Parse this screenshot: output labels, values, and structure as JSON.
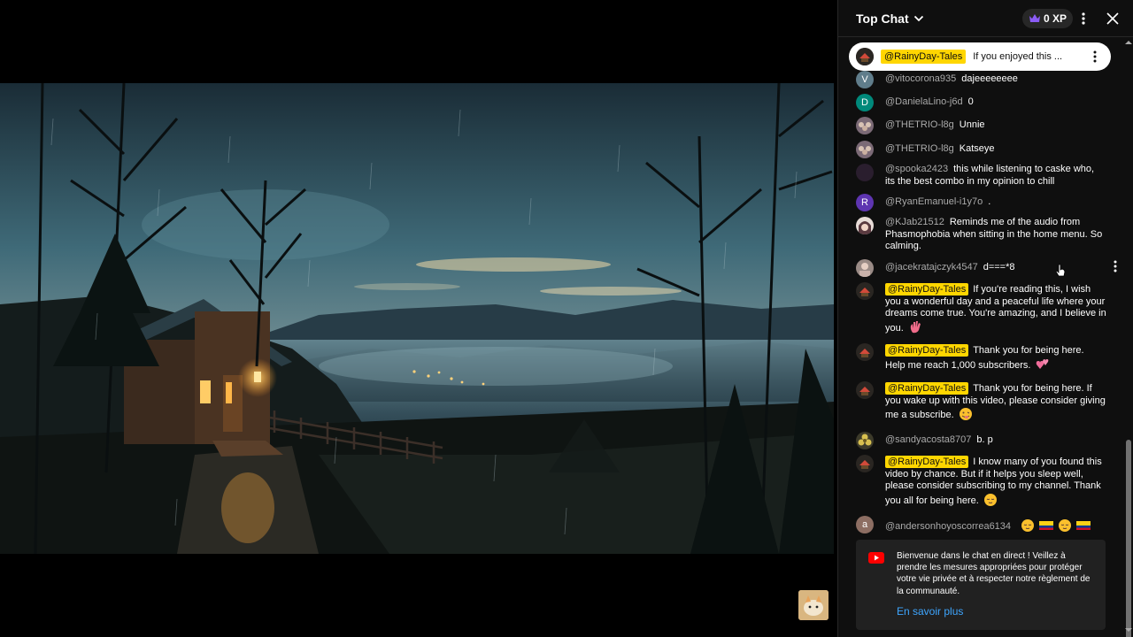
{
  "chat": {
    "title": "Top Chat",
    "xp": "0 XP",
    "pinned": {
      "author": "@RainyDay-Tales",
      "text": "If you enjoyed this ..."
    },
    "messages": [
      {
        "author": "@vitocorona935",
        "text": "dajeeeeeeee",
        "avatar_letter": "V",
        "avatar_color": "#607d8b"
      },
      {
        "author": "@DanielaLino-j6d",
        "text": "0",
        "avatar_letter": "D",
        "avatar_color": "#00897b"
      },
      {
        "author": "@THETRIO-l8g",
        "text": "Unnie",
        "avatar_letter": "",
        "avatar_color": "#6d5a6a"
      },
      {
        "author": "@THETRIO-l8g",
        "text": "Katseye",
        "avatar_letter": "",
        "avatar_color": "#6d5a6a"
      },
      {
        "author": "@spooka2423",
        "text": "this while listening to caske who, its the best combo in my opinion to chill",
        "avatar_letter": "",
        "avatar_color": "#2a1e2e"
      },
      {
        "author": "@RyanEmanuel-i1y7o",
        "text": ".",
        "avatar_letter": "R",
        "avatar_color": "#5e35b1"
      },
      {
        "author": "@KJab21512",
        "text": "Reminds me of the audio from Phasmophobia when sitting in the home menu. So calming.",
        "avatar_letter": "",
        "avatar_color": "#c9b8b0"
      },
      {
        "author": "@jacekratajczyk4547",
        "text": "d===*8",
        "avatar_letter": "",
        "avatar_color": "#8d7f7a"
      },
      {
        "author": "@RainyDay-Tales",
        "owner": true,
        "text": "If you're reading this, I wish you a wonderful day and a peaceful life where your dreams come true. You're amazing, and I believe in you.",
        "emoji": "wave",
        "avatar_letter": "",
        "avatar_color": "#2b2b2b"
      },
      {
        "author": "@RainyDay-Tales",
        "owner": true,
        "text": "Thank you for being here. Help me reach 1,000 subscribers.",
        "emoji": "hearts",
        "avatar_letter": "",
        "avatar_color": "#2b2b2b"
      },
      {
        "author": "@RainyDay-Tales",
        "owner": true,
        "text": "Thank you for being here. If you wake up with this video, please consider giving me a subscribe.",
        "emoji": "tongue",
        "avatar_letter": "",
        "avatar_color": "#2b2b2b"
      },
      {
        "author": "@sandyacosta8707",
        "text": "b. p",
        "avatar_letter": "",
        "avatar_color": "#b39b3f"
      },
      {
        "author": "@RainyDay-Tales",
        "owner": true,
        "text": "I know many of you found this video by chance. But if it helps you sleep well, please consider subscribing to my channel. Thank you all for being here.",
        "emoji": "sleepy",
        "avatar_letter": "",
        "avatar_color": "#2b2b2b"
      },
      {
        "author": "@andersonhoyoscorrea6134",
        "text": "",
        "emoji_row": [
          "sleepy",
          "colombia",
          "sleepy",
          "colombia"
        ],
        "avatar_letter": "a",
        "avatar_color": "#8d6e63"
      }
    ],
    "welcome": {
      "text": "Bienvenue dans le chat en direct ! Veillez à prendre les mesures appropriées pour protéger votre vie privée et à respecter notre règlement de la communauté.",
      "link": "En savoir plus"
    }
  },
  "colors": {
    "owner_badge": "#ffd600",
    "link": "#3ea6ff",
    "panel_bg": "#0f0f0f"
  },
  "icons": [
    "chevron-down-icon",
    "crown-icon",
    "more-vert-icon",
    "close-icon",
    "youtube-icon"
  ]
}
